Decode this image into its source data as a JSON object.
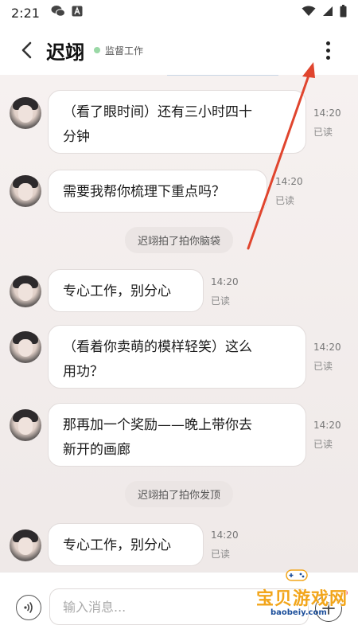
{
  "status_bar": {
    "time": "2:21"
  },
  "header": {
    "name": "迟翊",
    "status": "监督工作"
  },
  "messages": [
    {
      "lines": [
        "（看了眼时间）还有三小时四十",
        "分钟"
      ],
      "time": "14:20",
      "read": "已读"
    },
    {
      "lines": [
        "需要我帮你梳理下重点吗？"
      ],
      "time": "14:20",
      "read": "已读"
    },
    {
      "lines": [
        "专心工作，别分心"
      ],
      "time": "14:20",
      "read": "已读"
    },
    {
      "lines": [
        "（看着你卖萌的模样轻笑）这么",
        "用功？"
      ],
      "time": "14:20",
      "read": "已读"
    },
    {
      "lines": [
        "那再加一个奖励——晚上带你去",
        "新开的画廊"
      ],
      "time": "14:20",
      "read": "已读"
    },
    {
      "lines": [
        "专心工作，别分心"
      ],
      "time": "14:20",
      "read": "已读"
    }
  ],
  "system_messages": [
    "迟翊拍了拍你脑袋",
    "迟翊拍了拍你发顶"
  ],
  "input": {
    "placeholder": "输入消息..."
  },
  "watermark": {
    "text": "宝贝游戏网",
    "url": "baobeiy.com"
  },
  "colors": {
    "annotation_arrow": "#e0452e",
    "online_dot": "#9ad8a6",
    "watermark": "#f2a51a"
  }
}
